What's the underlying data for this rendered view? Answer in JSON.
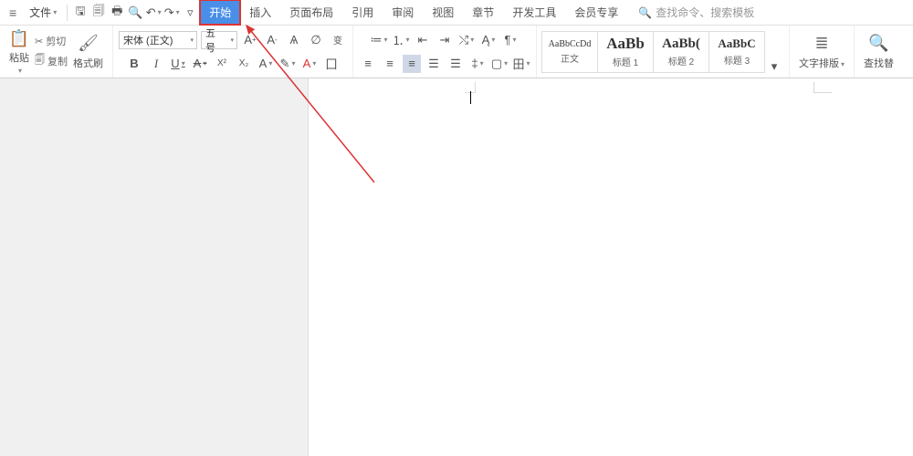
{
  "menu": {
    "file_label": "文件",
    "tabs": [
      "开始",
      "插入",
      "页面布局",
      "引用",
      "审阅",
      "视图",
      "章节",
      "开发工具",
      "会员专享"
    ],
    "active_tab": "开始",
    "search_placeholder": "查找命令、搜索模板"
  },
  "clipboard": {
    "paste_label": "粘贴",
    "cut_label": "剪切",
    "copy_label": "复制",
    "format_painter_label": "格式刷"
  },
  "font": {
    "name": "宋体 (正文)",
    "size": "五号"
  },
  "styles": [
    {
      "preview": "AaBbCcDd",
      "label": "正文",
      "size": "10px",
      "weight": "normal"
    },
    {
      "preview": "AaBb",
      "label": "标题 1",
      "size": "17px",
      "weight": "bold"
    },
    {
      "preview": "AaBb(",
      "label": "标题 2",
      "size": "15px",
      "weight": "bold"
    },
    {
      "preview": "AaBbC",
      "label": "标题 3",
      "size": "13px",
      "weight": "bold"
    }
  ],
  "right_groups": {
    "text_layout": "文字排版",
    "find_replace": "查找替"
  },
  "colors": {
    "active_tab_bg": "#4a8fe7",
    "highlight_box": "#d33"
  }
}
